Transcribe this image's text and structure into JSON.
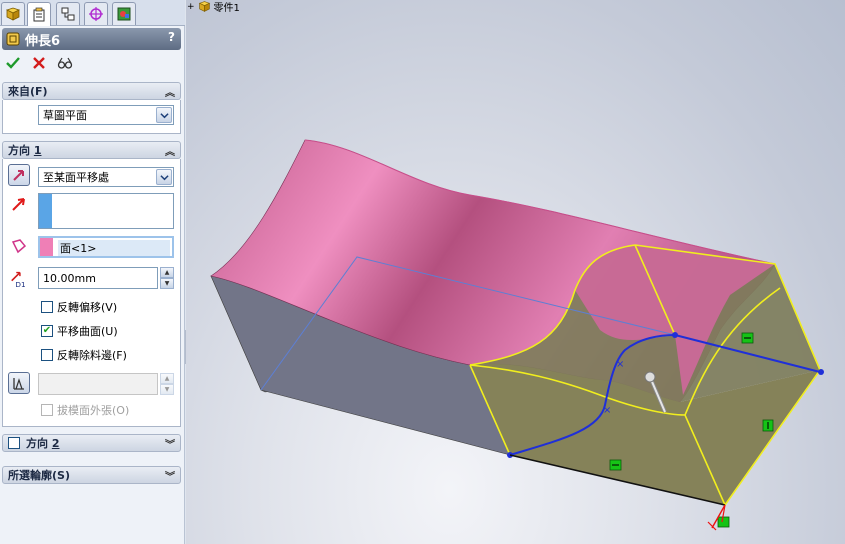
{
  "panel": {
    "title": "伸長6",
    "help": "?",
    "from_group": {
      "header": "來自(F)",
      "selected": "草圖平面"
    },
    "direction1": {
      "header_text": "方向 ",
      "header_num": "1",
      "end_condition": "至某面平移處",
      "face_selection": "面<1>",
      "distance": "10.00mm",
      "distance_icon_label": "D1",
      "reverse_offset": "反轉偏移(V)",
      "translate_surface": "平移曲面(U)",
      "flip_side_cut": "反轉除料邊(F)",
      "draft_outward": "拔模面外張(O)",
      "translate_surface_checked": true
    },
    "direction2": {
      "header_text": "方向 ",
      "header_num": "2"
    },
    "selected_contours": {
      "header": "所選輪廓(S)"
    }
  },
  "viewport": {
    "tree_root": "零件1"
  },
  "colors": {
    "accent_blue": "#5aa5e6",
    "face_pink": "#ef7fb6",
    "preview_yellow": "#f1ee1e",
    "sketch_blue": "#1f2fd8"
  }
}
